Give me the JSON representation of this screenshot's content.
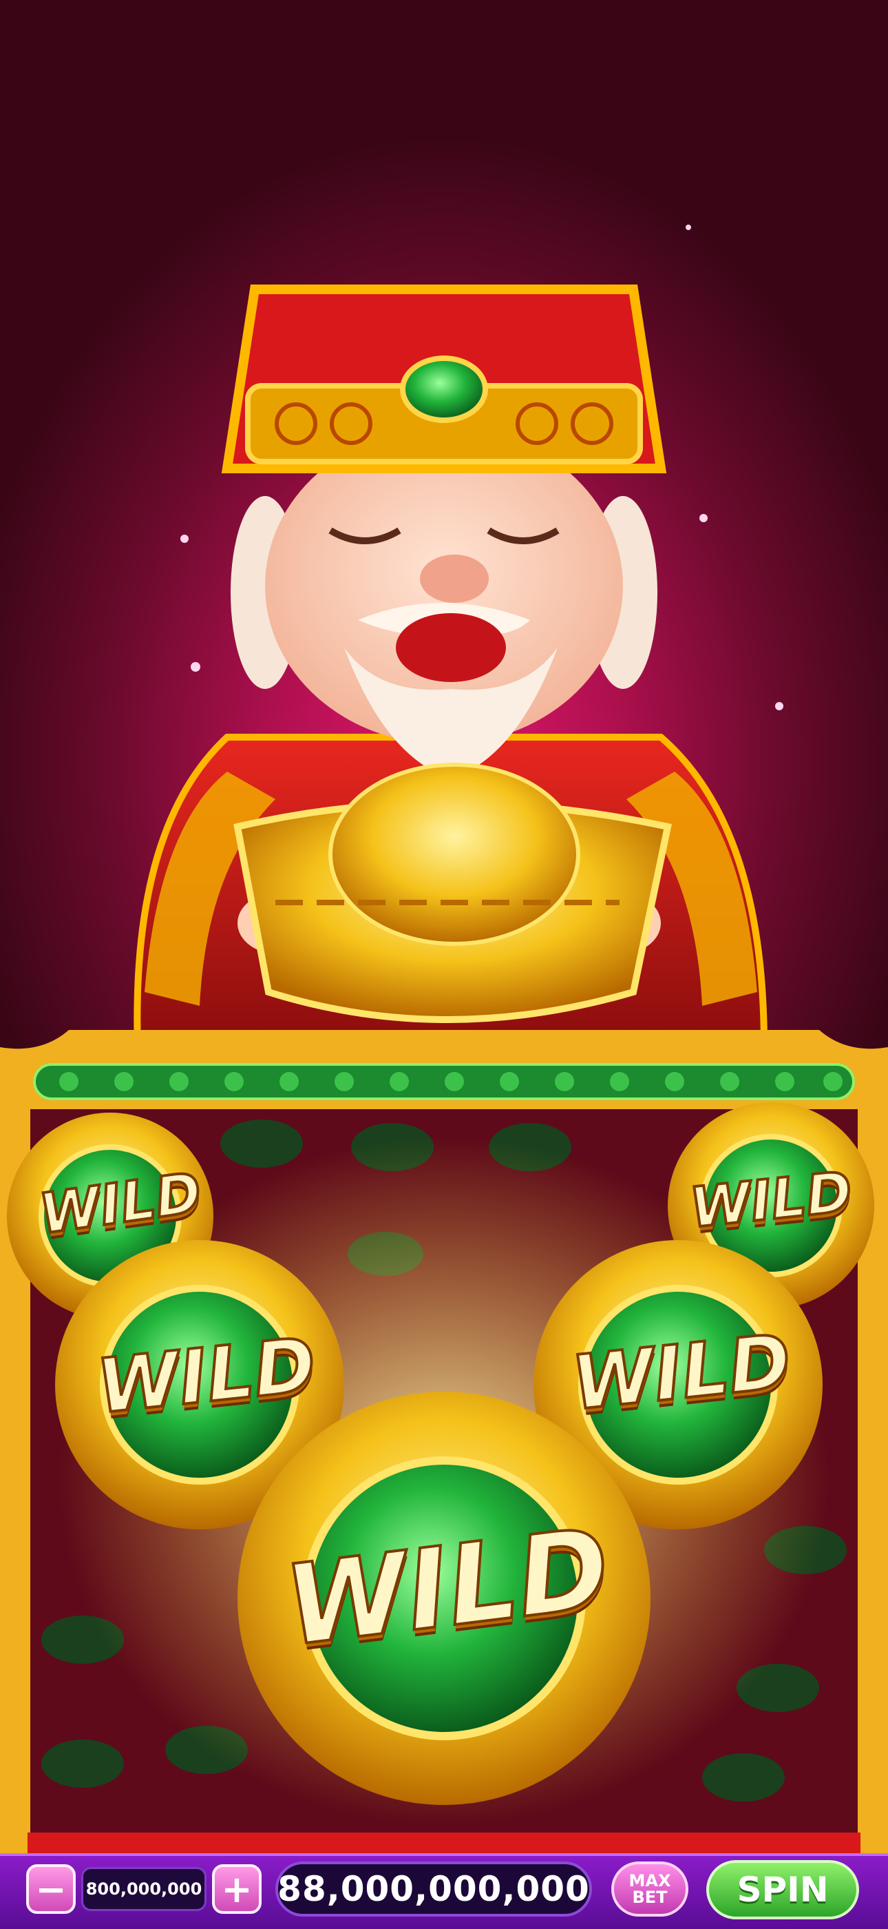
{
  "game": {
    "wild_symbols": [
      "WILD",
      "WILD",
      "WILD",
      "WILD",
      "WILD"
    ]
  },
  "controls": {
    "minus_label": "−",
    "plus_label": "+",
    "bet_amount": "800,000,000",
    "balance": "88,000,000,000",
    "max_bet_label_line1": "MAX",
    "max_bet_label_line2": "BET",
    "spin_label": "SPIN"
  },
  "colors": {
    "background": "#b0104f",
    "bar": "#6a16b0",
    "spin": "#3dbb30",
    "gold": "#f5c21a",
    "emerald": "#1fa63a"
  }
}
